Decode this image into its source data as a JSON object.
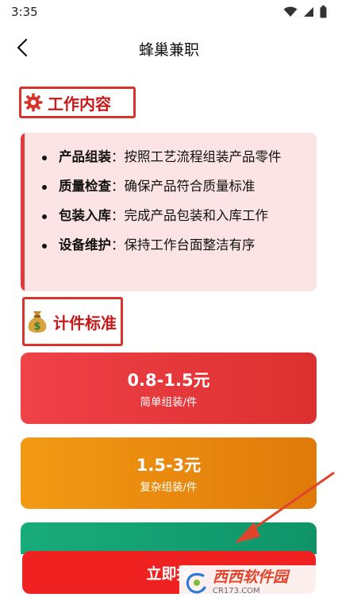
{
  "status_bar": {
    "time": "3:35"
  },
  "app_bar": {
    "title": "蜂巢兼职"
  },
  "job_section": {
    "title": "工作内容",
    "items": [
      {
        "key": "产品组装",
        "sep": "：",
        "value": "按照工艺流程组装产品零件"
      },
      {
        "key": "质量检查",
        "sep": "：",
        "value": "确保产品符合质量标准"
      },
      {
        "key": "包装入库",
        "sep": "：",
        "value": "完成产品包装和入库工作"
      },
      {
        "key": "设备维护",
        "sep": "：",
        "value": "保持工作台面整洁有序"
      }
    ]
  },
  "rate_section": {
    "title": "计件标准",
    "rates": [
      {
        "price": "0.8-1.5元",
        "desc": "简单组装/件",
        "color": "#e63a3f"
      },
      {
        "price": "1.5-3元",
        "desc": "复杂组装/件",
        "color": "#ec8c0e"
      },
      {
        "price": "",
        "desc": "",
        "color": "#15a06f"
      }
    ]
  },
  "apply_button": {
    "label": "立即报"
  },
  "watermark": {
    "brand": "西西软件园",
    "url": "CR173.COM"
  },
  "colors": {
    "accent": "#d9342b",
    "title_red": "#c8191b",
    "card_pink": "#fde4e4",
    "button_red": "#ef2121"
  }
}
